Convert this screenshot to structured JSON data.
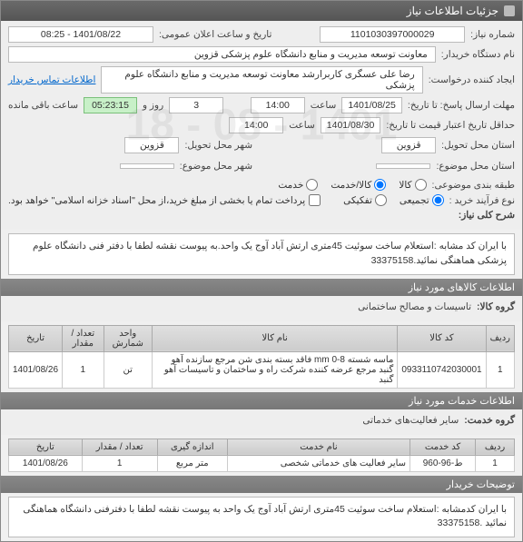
{
  "window": {
    "title": "جزئیات اطلاعات نیاز"
  },
  "form": {
    "req_no_lbl": "شماره نیاز:",
    "req_no": "1101030397000029",
    "ann_dt_lbl": "تاریخ و ساعت اعلان عمومی:",
    "ann_dt": "1401/08/22 - 08:25",
    "buyer_lbl": "نام دستگاه خریدار:",
    "buyer": "معاونت توسعه مدیریت و منابع دانشگاه علوم پزشکی قزوین",
    "creator_lbl": "ایجاد کننده درخواست:",
    "creator": "رضا علی عسگری کاربرارشد معاونت توسعه مدیریت و منابع دانشگاه علوم پزشکی",
    "contact_link": "اطلاعات تماس خریدار",
    "deadline_lbl": "مهلت ارسال پاسخ: تا تاریخ:",
    "deadline_date": "1401/08/25",
    "time_lbl": "ساعت",
    "deadline_time": "14:00",
    "days_left": "3",
    "days_left_lbl": "روز و",
    "time_left": "05:23:15",
    "time_left_lbl": "ساعت باقی مانده",
    "valid_lbl": "حداقل تاریخ اعتبار قیمت تا تاریخ:",
    "valid_date": "1401/08/30",
    "valid_time": "14:00",
    "prov_req_lbl": "استان محل تحویل:",
    "prov_req": "قزوین",
    "city_req_lbl": "شهر محل تحویل:",
    "city_req": "قزوین",
    "prov_sup_lbl": "استان محل موضوع:",
    "city_sup_lbl": "شهر محل موضوع:",
    "class_lbl": "طبقه بندی موضوعی:",
    "class_goods": "کالا",
    "class_serv": "کالا/خدمت",
    "class_both": "خدمت",
    "proc_lbl": "نوع فرآیند خرید :",
    "proc_a": "تجمیعی",
    "proc_b": "تفکیکی",
    "pay_note": "پرداخت تمام یا بخشی از مبلغ خرید،از محل \"اسناد خزانه اسلامی\" خواهد بود.",
    "overall_lbl": "شرح کلی نیاز:",
    "overall_desc": "با ایران کد مشابه :استعلام ساخت سوئیت 45متری ارتش آباد آوج یک واحد.به پیوست نقشه   لطفا با دفتر فنی دانشگاه علوم پزشکی هماهنگی نمائید.33375158"
  },
  "goods": {
    "hdr": "اطلاعات کالاهای مورد نیاز",
    "group_lbl": "گروه کالا:",
    "group": "تاسیسات و مصالح ساختمانی",
    "cols": {
      "idx": "ردیف",
      "code": "کد کالا",
      "name": "نام کالا",
      "unit": "واحد شمارش",
      "qty": "تعداد / مقدار",
      "date": "تاریخ"
    },
    "rows": [
      {
        "idx": "1",
        "code": "0933110742030001",
        "name": "ماسه شسته 8-0 mm فاقد بسته بندی شن مرجع سازنده آهو گنبد مرجع عرضه کننده شرکت راه و ساختمان و تاسیسات آهو گنبد",
        "unit": "تن",
        "qty": "1",
        "date": "1401/08/26"
      }
    ]
  },
  "services": {
    "hdr": "اطلاعات خدمات مورد نیاز",
    "group_lbl": "گروه خدمت:",
    "group": "سایر فعالیت‌های خدماتی",
    "cols": {
      "idx": "ردیف",
      "code": "کد خدمت",
      "name": "نام خدمت",
      "unit": "اندازه گیری",
      "qty": "تعداد / مقدار",
      "date": "تاریخ"
    },
    "rows": [
      {
        "idx": "1",
        "code": "ط-96-960",
        "name": "سایر فعالیت های خدماتی شخصی",
        "unit": "متر مربع",
        "qty": "1",
        "date": "1401/08/26"
      }
    ]
  },
  "notes": {
    "hdr": "توضیحات خریدار",
    "text": "با ایران کدمشابه :استعلام ساخت سوئیت 45متری ارتش آباد آوج یک واحد به پیوست نقشه لطفا با دفترفنی دانشگاه هماهنگی نمائید .33375158"
  },
  "watermark": "1401 - 08 - 18"
}
